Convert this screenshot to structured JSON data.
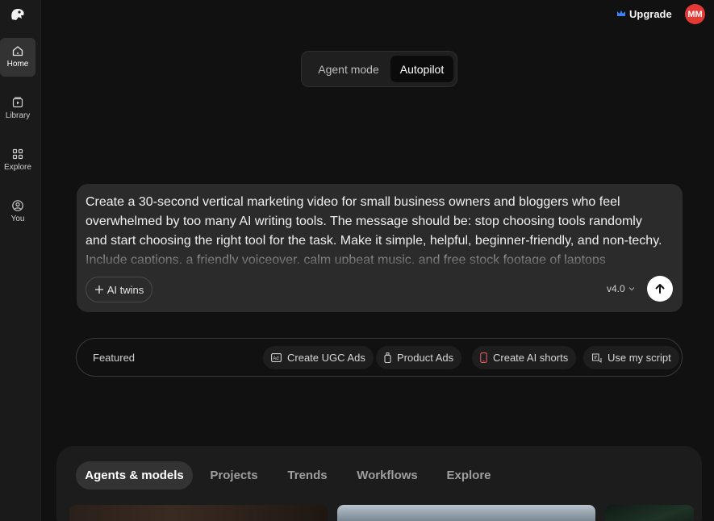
{
  "header": {
    "upgrade_label": "Upgrade",
    "avatar_initials": "MM"
  },
  "sidebar": {
    "items": [
      {
        "label": "Home",
        "icon": "home-icon"
      },
      {
        "label": "Library",
        "icon": "library-icon"
      },
      {
        "label": "Explore",
        "icon": "grid-icon"
      },
      {
        "label": "You",
        "icon": "user-icon"
      }
    ]
  },
  "mode": {
    "agent_label": "Agent mode",
    "autopilot_label": "Autopilot",
    "selected": "Autopilot"
  },
  "prompt": {
    "text": "Create a 30-second vertical marketing video for small business owners and bloggers who feel overwhelmed by too many AI writing tools. The message should be: stop choosing tools randomly and start choosing the right tool for the task. Make it simple, helpful, beginner-friendly, and non-techy. Include captions, a friendly voiceover, calm upbeat music, and free stock footage of laptops",
    "twins_label": "AI twins",
    "version": "v4.0"
  },
  "featured": {
    "label": "Featured",
    "chips": [
      {
        "label": "Create UGC Ads",
        "icon": "ad-icon"
      },
      {
        "label": "Product Ads",
        "icon": "bottle-icon"
      },
      {
        "label": "Create AI shorts",
        "icon": "phone-icon"
      },
      {
        "label": "Use my script",
        "icon": "script-icon"
      }
    ]
  },
  "tabs": [
    {
      "label": "Agents & models",
      "active": true
    },
    {
      "label": "Projects"
    },
    {
      "label": "Trends"
    },
    {
      "label": "Workflows"
    },
    {
      "label": "Explore"
    }
  ],
  "colors": {
    "accent_avatar": "#e53935",
    "upgrade_crown": "#3b82f6",
    "background": "#111111"
  }
}
